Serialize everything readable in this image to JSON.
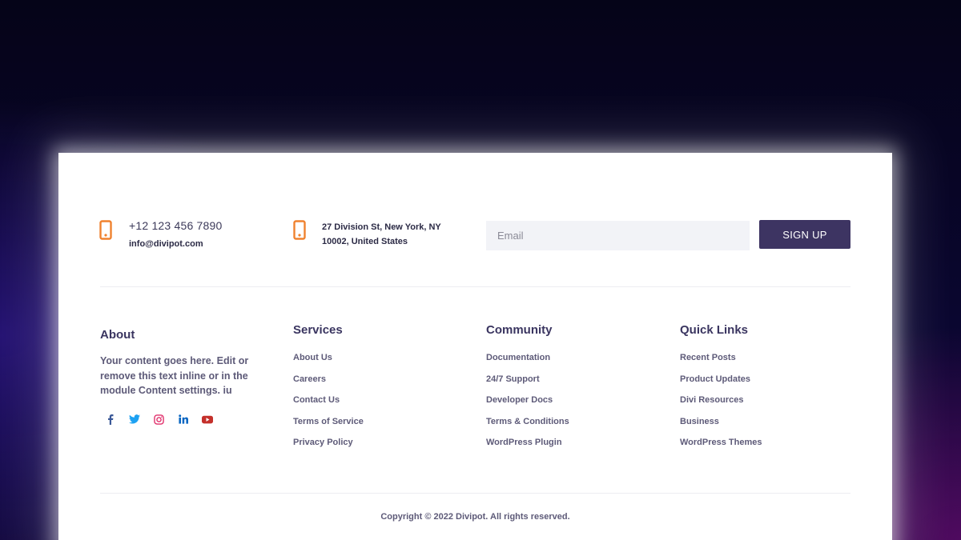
{
  "contact": {
    "phone": "+12 123 456 7890",
    "email": "info@divipot.com",
    "address_line1": "27 Division St, New York, NY",
    "address_line2": "10002, United States"
  },
  "newsletter": {
    "email_placeholder": "Email",
    "email_value": "",
    "signup_label": "SIGN UP"
  },
  "about": {
    "title": "About",
    "text": "Your content goes here. Edit or remove this text inline or in the module Content settings. iu",
    "social_icons": [
      "facebook-icon",
      "twitter-icon",
      "instagram-icon",
      "linkedin-icon",
      "youtube-icon"
    ]
  },
  "services": {
    "title": "Services",
    "links": [
      "About Us",
      "Careers",
      "Contact Us",
      "Terms of Service",
      "Privacy Policy"
    ]
  },
  "community": {
    "title": "Community",
    "links": [
      "Documentation",
      "24/7 Support",
      "Developer Docs",
      "Terms & Conditions",
      "WordPress Plugin"
    ]
  },
  "quick_links": {
    "title": "Quick Links",
    "links": [
      "Recent Posts",
      "Product Updates",
      "Divi Resources",
      "Business",
      "WordPress Themes"
    ]
  },
  "footer": {
    "copyright": "Copyright © 2022 Divipot. All rights reserved."
  },
  "colors": {
    "accent_orange": "#f0822f",
    "button_purple": "#3d3462",
    "heading": "#3a3560",
    "body_text": "#5d5a78",
    "facebook": "#3b5998",
    "twitter": "#1da1f2",
    "instagram": "#e1306c",
    "linkedin": "#0a66c2",
    "youtube": "#c4302b"
  }
}
